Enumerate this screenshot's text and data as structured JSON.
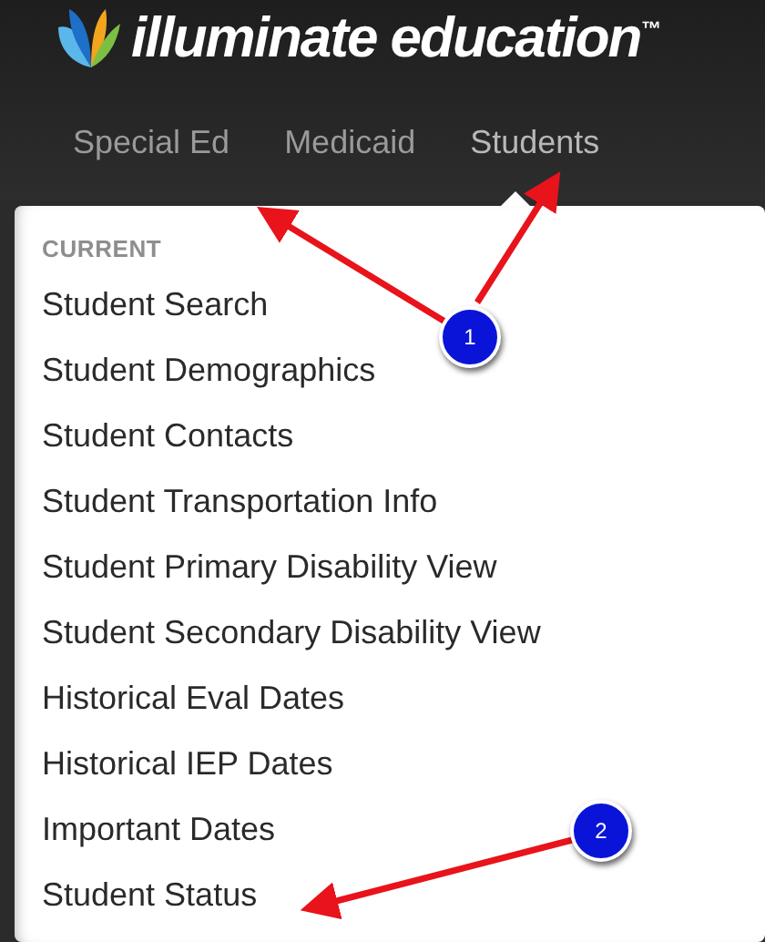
{
  "header": {
    "logo": "illuminate education$^{™}$",
    "tabs": [
      {
        "label": "Special Ed",
        "selected": false
      },
      {
        "label": "Medicaid",
        "selected": false
      },
      {
        "label": "Students",
        "selected": true
      }
    ]
  },
  "menu": {
    "heading": "CURRENT",
    "items": [
      "Student Search",
      "Student Demographics",
      "Student Contacts",
      "Student Transportation Info",
      "Student Primary Disability View",
      "Student Secondary Disability View",
      "Historical Eval Dates",
      "Historical IEP Dates",
      "Important Dates",
      "Student Status"
    ]
  },
  "callouts": [
    {
      "label": "1"
    },
    {
      "label": "2"
    }
  ]
}
